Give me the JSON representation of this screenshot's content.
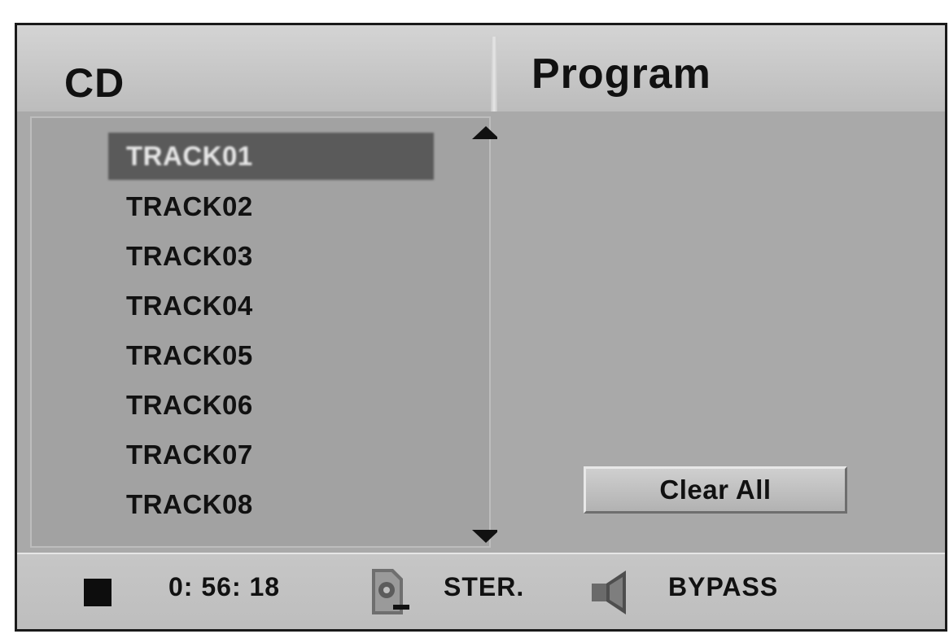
{
  "header": {
    "left_title": "CD",
    "right_title": "Program"
  },
  "cd_list": {
    "tracks": [
      "TRACK01",
      "TRACK02",
      "TRACK03",
      "TRACK04",
      "TRACK05",
      "TRACK06",
      "TRACK07",
      "TRACK08"
    ],
    "selected_index": 0
  },
  "program": {
    "clear_all_label": "Clear All"
  },
  "status_bar": {
    "playback_state_icon": "stop-icon",
    "time": "0: 56: 18",
    "audio_icon": "disc-icon",
    "audio_mode": "STER.",
    "speaker_icon": "speaker-icon",
    "sound_mode": "BYPASS"
  },
  "colors": {
    "panel_background": "#a9a9a9",
    "selection_background": "#5a5a5a",
    "header_background": "#c8c8c8"
  }
}
